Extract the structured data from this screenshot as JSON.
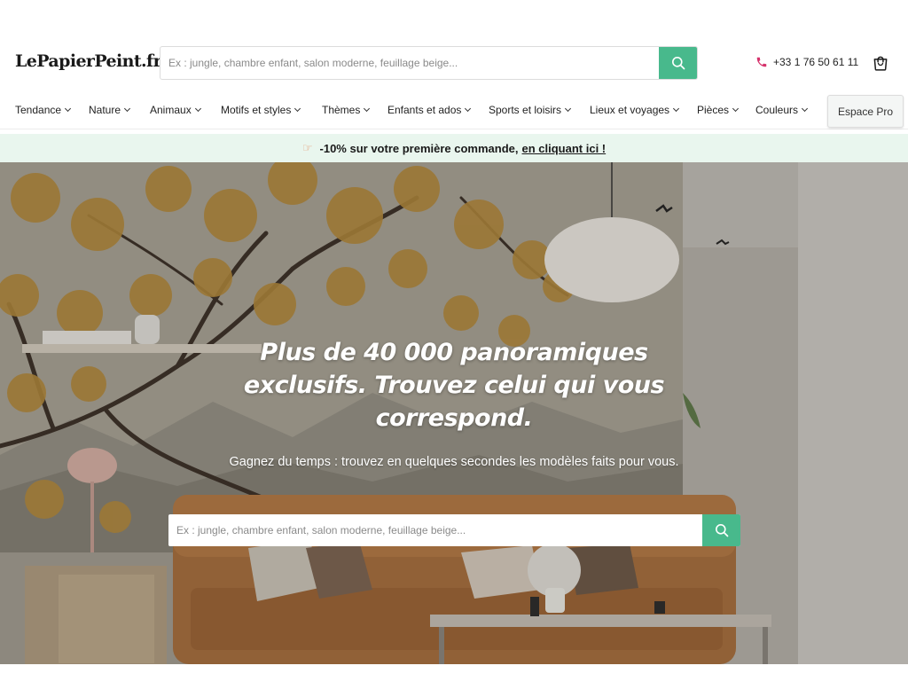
{
  "header": {
    "logo": "LePapierPeint.fr",
    "search_placeholder": "Ex : jungle, chambre enfant, salon moderne, feuillage beige...",
    "phone": "+33 1 76 50 61 11"
  },
  "nav": {
    "items": [
      {
        "label": "Tendance"
      },
      {
        "label": "Nature"
      },
      {
        "label": "Animaux"
      },
      {
        "label": "Motifs et styles"
      },
      {
        "label": "Thèmes"
      },
      {
        "label": "Enfants et ados"
      },
      {
        "label": "Sports et loisirs"
      },
      {
        "label": "Lieux et voyages"
      },
      {
        "label": "Pièces"
      },
      {
        "label": "Couleurs"
      }
    ],
    "pro_label": "Espace Pro"
  },
  "promo": {
    "text": "-10% sur votre première commande,",
    "link": "en cliquant ici !"
  },
  "hero": {
    "title": "Plus de 40 000 panoramiques exclusifs. Trouvez celui qui vous correspond.",
    "subtitle": "Gagnez du temps : trouvez en quelques secondes les modèles faits pour vous.",
    "search_placeholder": "Ex : jungle, chambre enfant, salon moderne, feuillage beige..."
  },
  "colors": {
    "accent": "#48b98c",
    "promo_bg": "#e9f6ee",
    "phone_icon": "#d6336c"
  },
  "icons": {
    "search": "search-icon",
    "phone": "phone-icon",
    "cart": "shopping-bag-icon",
    "promo": "pointing-hand-icon",
    "chevron": "chevron-down-icon"
  }
}
